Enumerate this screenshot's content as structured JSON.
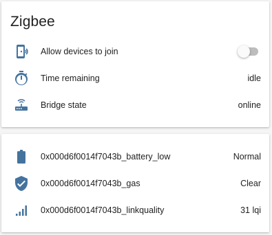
{
  "colors": {
    "icon": "#44739e",
    "text": "#212121",
    "toggle_track": "#bdbdbd",
    "toggle_thumb": "#fafafa"
  },
  "zigbee_card": {
    "title": "Zigbee",
    "rows": [
      {
        "icon": "cellphone-wireless-icon",
        "label": "Allow devices to join",
        "control": "toggle",
        "state": "off"
      },
      {
        "icon": "timer-icon",
        "label": "Time remaining",
        "value": "idle"
      },
      {
        "icon": "router-wireless-icon",
        "label": "Bridge state",
        "value": "online"
      }
    ]
  },
  "sensors_card": {
    "rows": [
      {
        "icon": "battery-icon",
        "label": "0x000d6f0014f7043b_battery_low",
        "value": "Normal"
      },
      {
        "icon": "shield-check-icon",
        "label": "0x000d6f0014f7043b_gas",
        "value": "Clear"
      },
      {
        "icon": "signal-icon",
        "label": "0x000d6f0014f7043b_linkquality",
        "value": "31 lqi"
      }
    ]
  }
}
